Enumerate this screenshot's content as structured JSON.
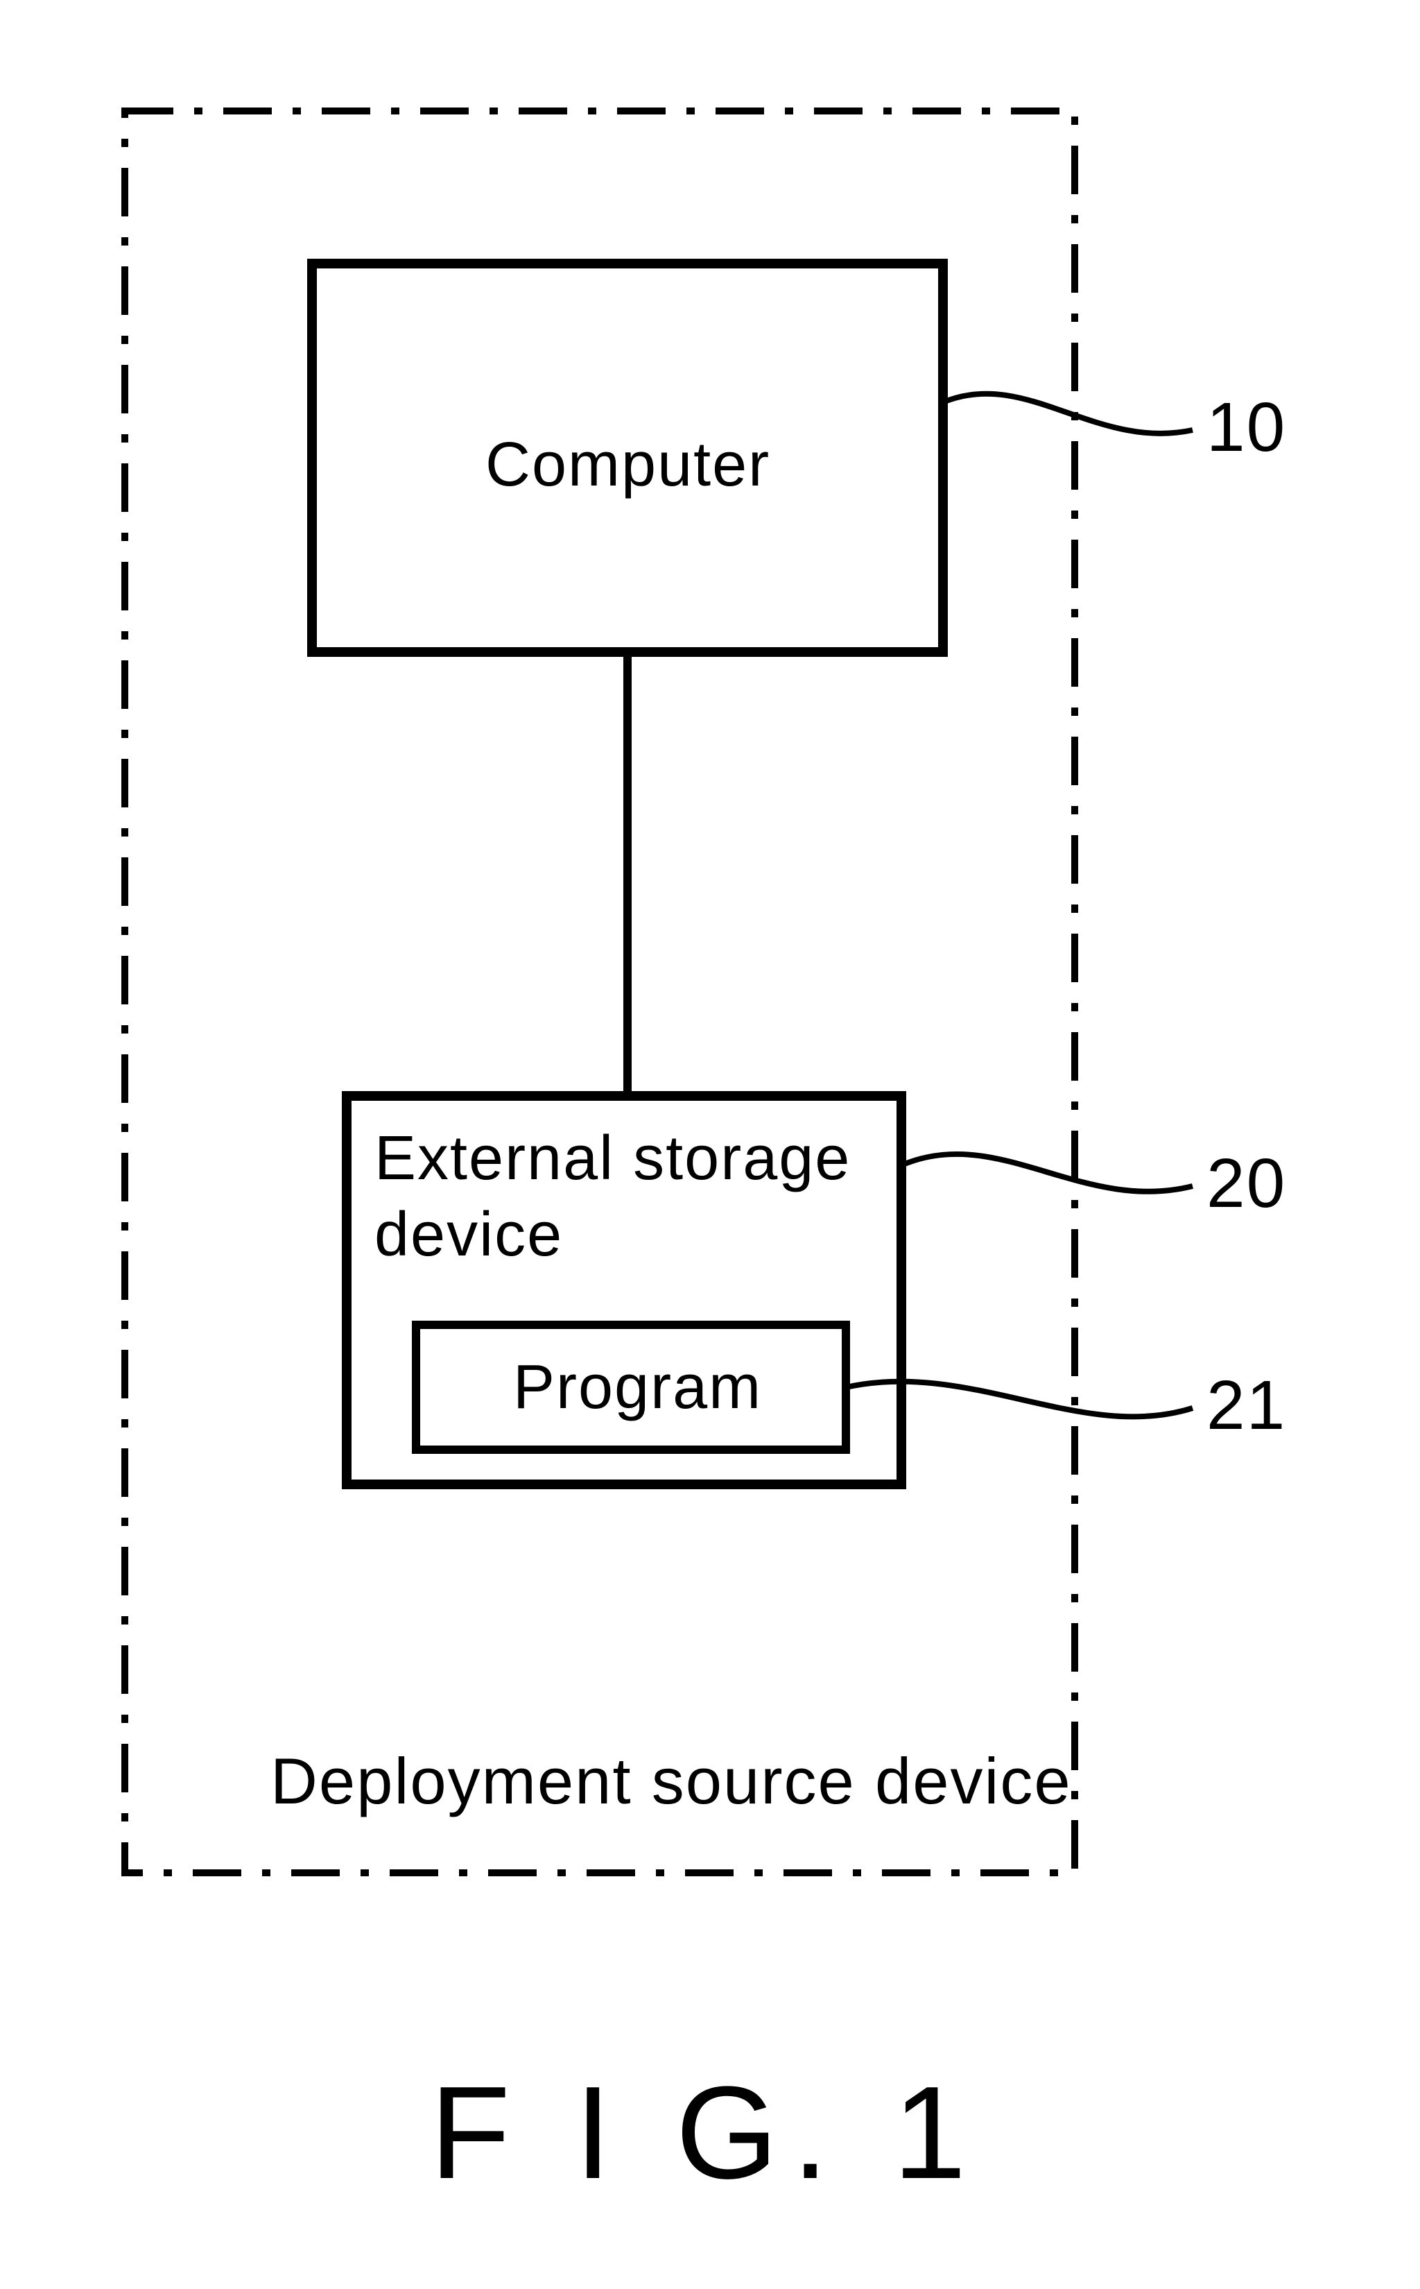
{
  "figure": {
    "caption": "F I G. 1",
    "borderLabel": "Deployment source device",
    "nodes": {
      "computer": {
        "label": "Computer",
        "ref": "10"
      },
      "storage": {
        "label1": "External storage",
        "label2": "device",
        "ref": "20"
      },
      "program": {
        "label": "Program",
        "ref": "21"
      }
    }
  }
}
